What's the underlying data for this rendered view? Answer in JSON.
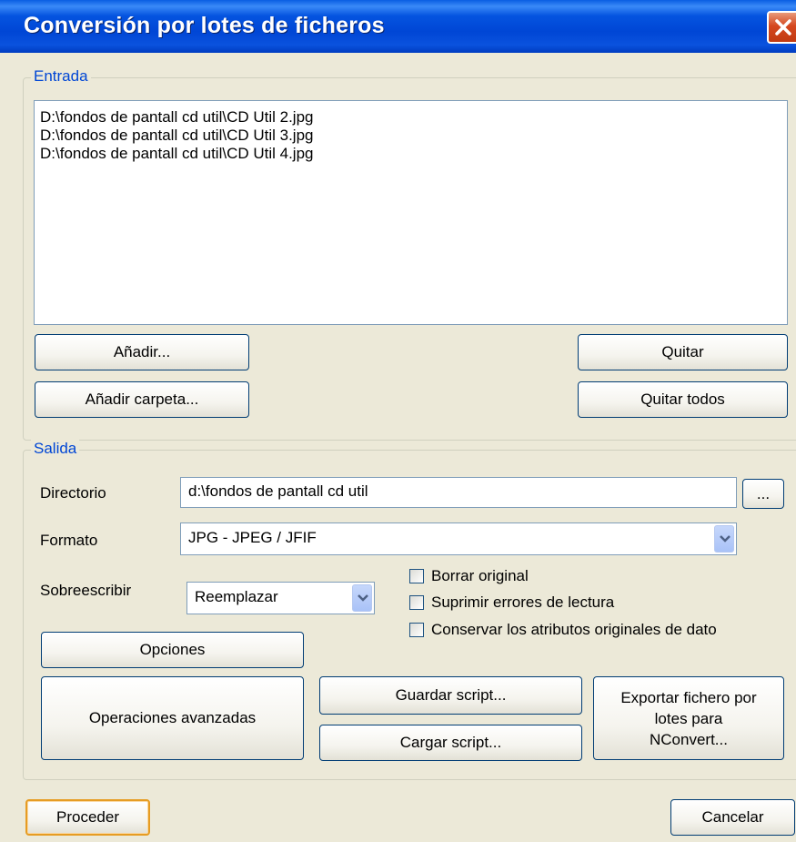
{
  "window": {
    "title": "Conversión por lotes de ficheros"
  },
  "entrada": {
    "label": "Entrada",
    "files": [
      "D:\\fondos de pantall cd util\\CD Util 2.jpg",
      "D:\\fondos de pantall cd util\\CD Util 3.jpg",
      "D:\\fondos de pantall cd util\\CD Util 4.jpg"
    ],
    "add_label": "Añadir...",
    "add_folder_label": "Añadir carpeta...",
    "remove_label": "Quitar",
    "remove_all_label": "Quitar todos"
  },
  "salida": {
    "label": "Salida",
    "directory_label": "Directorio",
    "directory_value": "d:\\fondos de pantall cd util",
    "browse_label": "...",
    "format_label": "Formato",
    "format_value": "JPG - JPEG / JFIF",
    "overwrite_label": "Sobreescribir",
    "overwrite_value": "Reemplazar",
    "checkboxes": [
      {
        "label": "Borrar original",
        "checked": false
      },
      {
        "label": "Suprimir errores de lectura",
        "checked": false
      },
      {
        "label": "Conservar los atributos originales de dato",
        "checked": false
      }
    ],
    "options_label": "Opciones",
    "advanced_label": "Operaciones avanzadas",
    "save_script_label": "Guardar script...",
    "load_script_label": "Cargar script...",
    "export_lines": [
      "Exportar fichero por",
      "lotes para",
      "NConvert..."
    ]
  },
  "footer": {
    "proceed_label": "Proceder",
    "cancel_label": "Cancelar"
  },
  "colors": {
    "title_bar": "#0046d5",
    "group_label": "#0046d5",
    "dialog_bg": "#ece9d8",
    "close_button": "#d5481f"
  }
}
